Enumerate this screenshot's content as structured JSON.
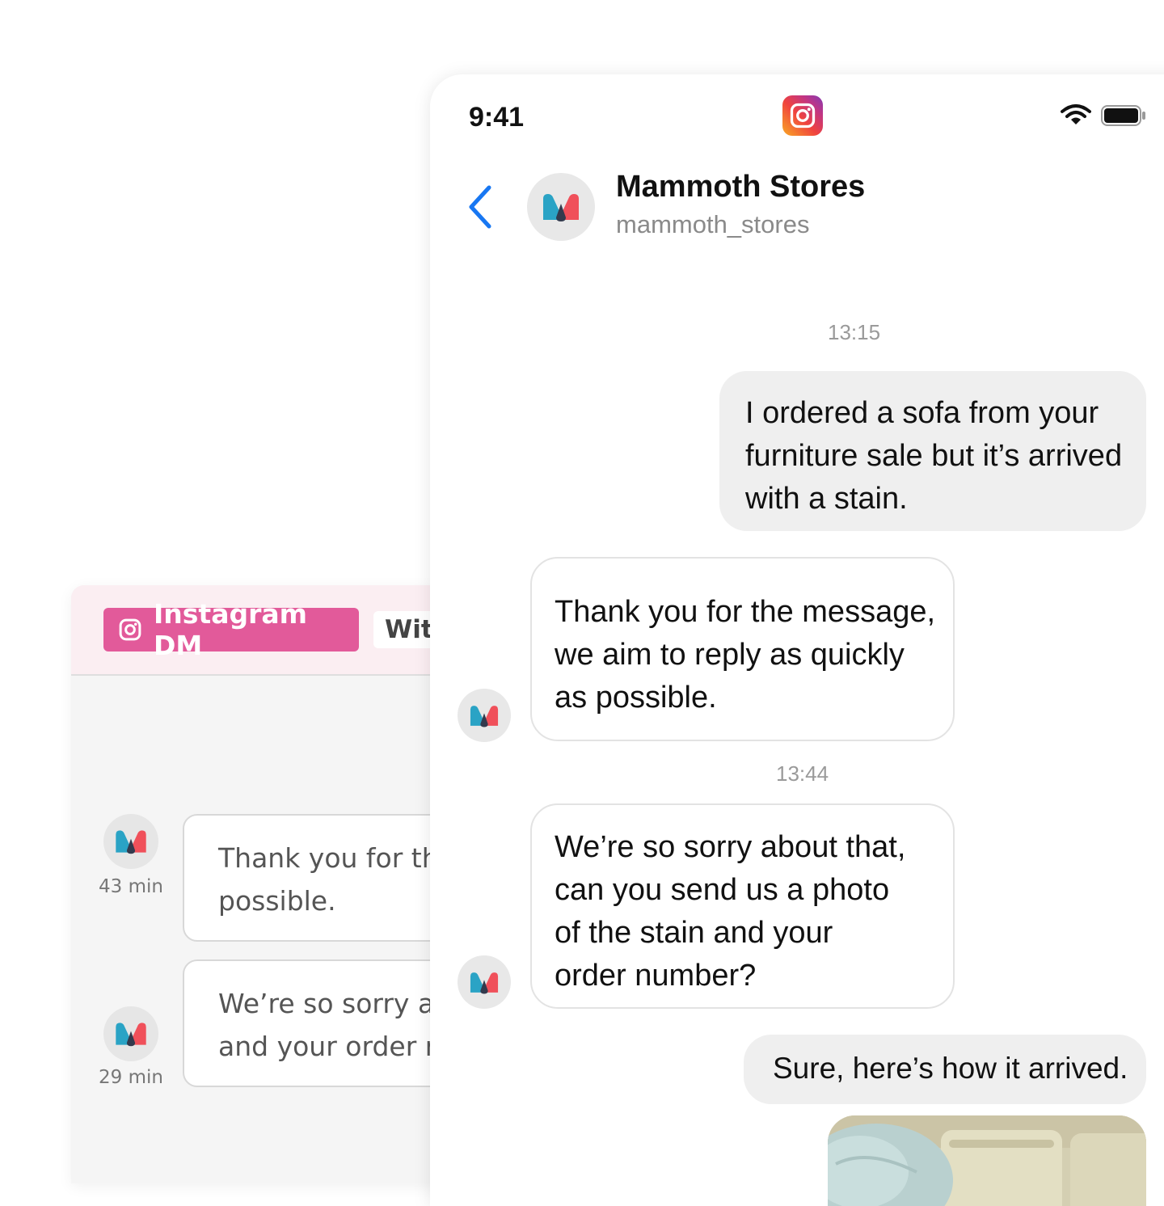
{
  "helpdesk": {
    "channel_label": "Instagram DM",
    "tab_label": "Wit",
    "messages": [
      {
        "time": "43 min",
        "lines": [
          "Thank you for th",
          "possible."
        ]
      },
      {
        "time": "29 min",
        "lines": [
          "We’re so sorry ab",
          "and your order r"
        ]
      }
    ],
    "colors": {
      "badge": "#e25a9a",
      "header": "#fbeef2"
    }
  },
  "phone": {
    "status": {
      "time": "9:41"
    },
    "app_icon": "instagram-icon",
    "contact": {
      "name": "Mammoth Stores",
      "handle": "mammoth_stores"
    },
    "timestamps": [
      "13:15",
      "13:44"
    ],
    "messages": [
      {
        "from": "customer",
        "lines": [
          "I ordered a sofa from your",
          "furniture sale but it’s arrived",
          "with a stain."
        ]
      },
      {
        "from": "store",
        "lines": [
          "Thank you for the message,",
          "we aim to reply as quickly",
          "as possible."
        ]
      },
      {
        "from": "store",
        "lines": [
          "We’re so sorry about that,",
          "can you send us a photo",
          "of the stain and your",
          "order number?"
        ]
      },
      {
        "from": "customer",
        "lines": [
          "Sure, here’s how it arrived."
        ]
      }
    ],
    "attachment": "sofa-photo",
    "colors": {
      "back_chevron": "#1877f2",
      "outgoing_bubble": "#efefef"
    }
  }
}
